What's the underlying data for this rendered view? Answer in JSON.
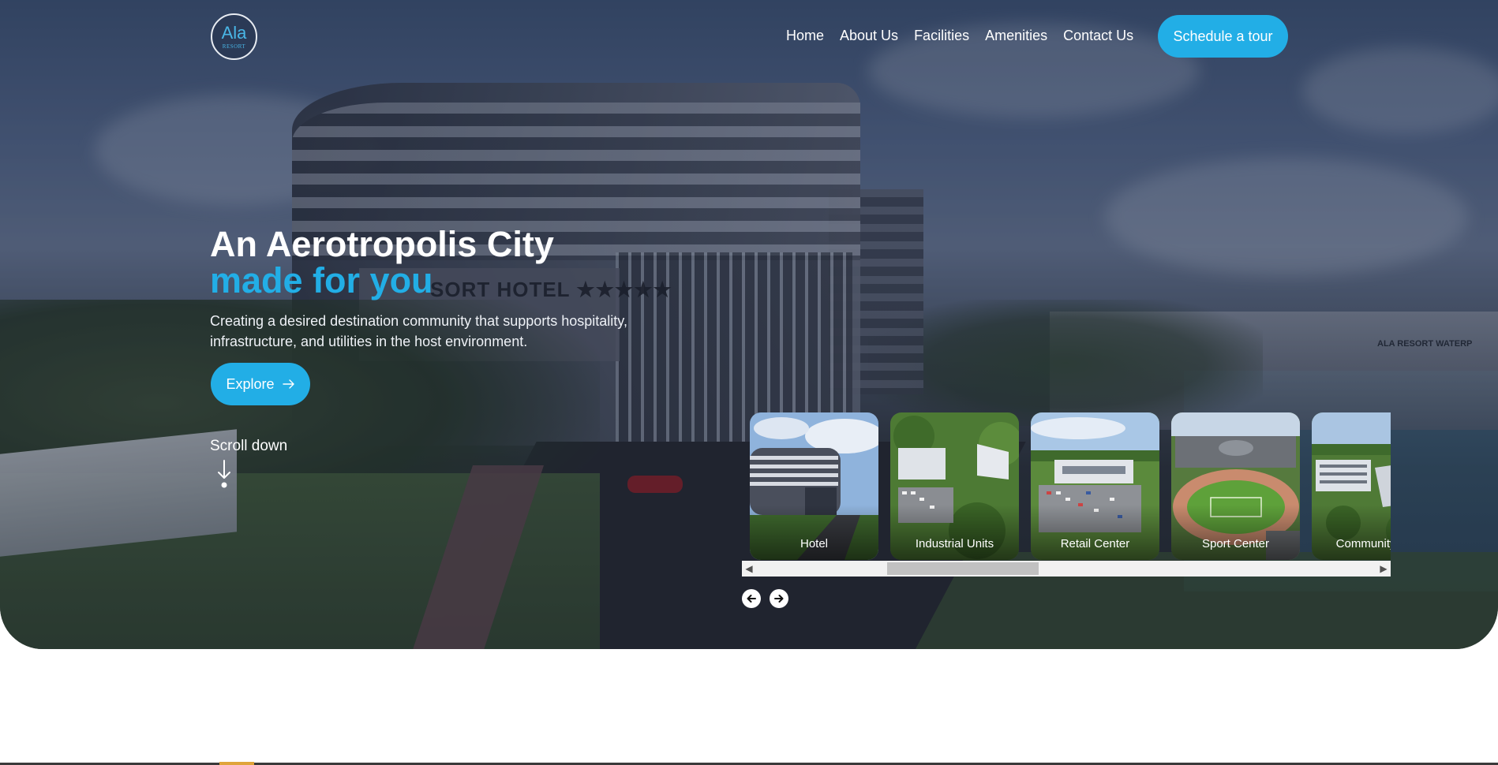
{
  "logo": {
    "mark": "Ala",
    "sub": "RESORT"
  },
  "nav": {
    "items": [
      "Home",
      "About Us",
      "Facilities",
      "Amenities",
      "Contact Us"
    ],
    "cta": "Schedule a tour"
  },
  "hero": {
    "title_line1": "An Aerotropolis City",
    "title_line2": "made for you",
    "subtitle": "Creating a desired destination community that supports hospitality, infrastructure, and utilities in the host environment.",
    "explore_label": "Explore",
    "scroll_label": "Scroll down",
    "sign_text": "SORT HOTEL  ★★★★★",
    "building_text": "ALA RESORT WATERP"
  },
  "carousel": {
    "cards": [
      {
        "label": "Hotel"
      },
      {
        "label": "Industrial Units"
      },
      {
        "label": "Retail Center"
      },
      {
        "label": "Sport Center"
      },
      {
        "label": "Community Civ"
      }
    ],
    "scroll_position": 0.28
  },
  "colors": {
    "accent": "#22aee6",
    "white": "#ffffff"
  }
}
